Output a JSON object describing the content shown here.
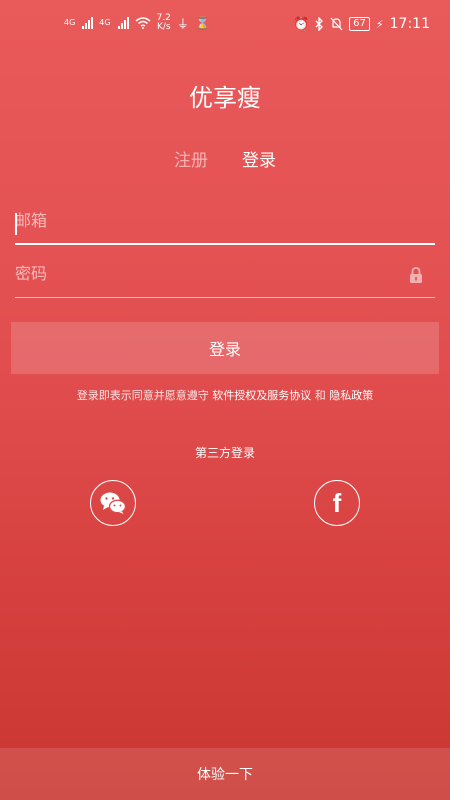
{
  "status_bar": {
    "net1": "4G",
    "net2": "4G",
    "speed_value": "7.2",
    "speed_unit": "K/s",
    "battery": "67",
    "time": "17:11"
  },
  "app": {
    "title": "优享瘦"
  },
  "tabs": [
    {
      "label": "注册",
      "active": false
    },
    {
      "label": "登录",
      "active": true
    }
  ],
  "form": {
    "email_placeholder": "邮箱",
    "password_placeholder": "密码",
    "login_label": "登录"
  },
  "agreement": {
    "prefix": "登录即表示同意并愿意遵守 ",
    "license_link": "软件授权及服务协议",
    "conjunction": " 和 ",
    "privacy_link": "隐私政策"
  },
  "third_party": {
    "title": "第三方登录",
    "providers": [
      "wechat",
      "facebook"
    ],
    "facebook_glyph": "f"
  },
  "bottom": {
    "try_label": "体验一下"
  },
  "colors": {
    "bg_top": "#e95a5b",
    "bg_bottom": "#c93630"
  }
}
